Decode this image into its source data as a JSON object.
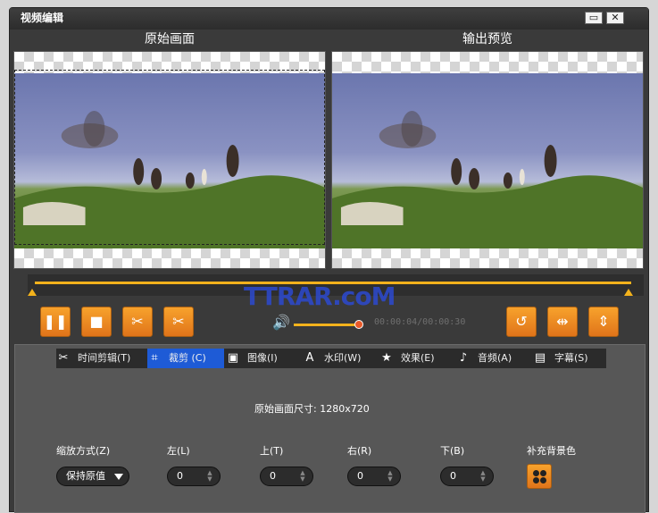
{
  "window": {
    "title": "视频编辑",
    "maximize_glyph": "▭",
    "close_glyph": "✕"
  },
  "preview": {
    "original_label": "原始画面",
    "output_label": "输出预览"
  },
  "controls": {
    "pause_icon": "pause-icon",
    "stop_icon": "stop-icon",
    "cut_icon": "scissors-icon",
    "split_icon": "split-icon",
    "undo_icon": "undo-icon",
    "mirror_icon": "mirror-icon",
    "flip_icon": "flip-icon",
    "volume_icon": "speaker-icon",
    "volume_level": 0.95,
    "time": "00:00:04/00:00:30",
    "watermark_logo": "TTRAR.coM",
    "accent_color": "#f3b21c"
  },
  "tabs": [
    {
      "label": "时间剪辑(T)",
      "icon": "scissors-icon",
      "active": false
    },
    {
      "label": "裁剪 (C)",
      "icon": "crop-icon",
      "active": true
    },
    {
      "label": "图像(I)",
      "icon": "image-icon",
      "active": false
    },
    {
      "label": "水印(W)",
      "icon": "watermark-icon",
      "active": false
    },
    {
      "label": "效果(E)",
      "icon": "star-icon",
      "active": false
    },
    {
      "label": "音频(A)",
      "icon": "music-note-icon",
      "active": false
    },
    {
      "label": "字幕(S)",
      "icon": "subtitle-icon",
      "active": false
    }
  ],
  "crop": {
    "original_size_label": "原始画面尺寸: 1280x720",
    "zoom_label": "缩放方式(Z)",
    "zoom_value": "保持原值",
    "left_label": "左(L)",
    "left_value": "0",
    "top_label": "上(T)",
    "top_value": "0",
    "right_label": "右(R)",
    "right_value": "0",
    "bottom_label": "下(B)",
    "bottom_value": "0",
    "bg_color_label": "补充背景色"
  }
}
